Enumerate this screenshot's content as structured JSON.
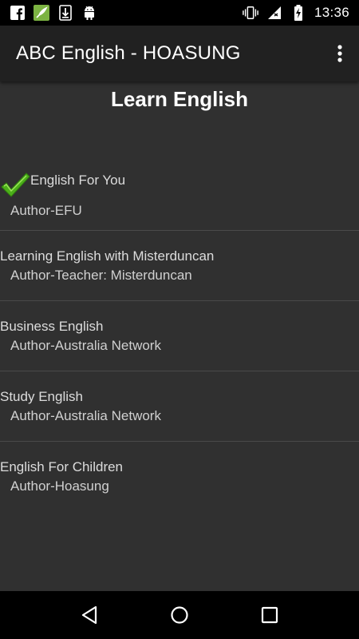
{
  "status_bar": {
    "time": "13:36",
    "left_icons": [
      "facebook-icon",
      "feather-app-icon",
      "download-icon",
      "android-icon"
    ],
    "right_icons": [
      "vibrate-icon",
      "signal-icon",
      "battery-charging-icon"
    ]
  },
  "app_bar": {
    "title": "ABC English - HOASUNG",
    "overflow_icon": "more-vert-icon"
  },
  "main": {
    "heading": "Learn English",
    "items": [
      {
        "title": "English For You",
        "author": "Author-EFU",
        "checked": true
      },
      {
        "title": "Learning English with Misterduncan",
        "author": "Author-Teacher: Misterduncan",
        "checked": false
      },
      {
        "title": "Business English",
        "author": "Author-Australia Network",
        "checked": false
      },
      {
        "title": "Study English",
        "author": "Author-Australia Network",
        "checked": false
      },
      {
        "title": "English For Children",
        "author": "Author-Hoasung",
        "checked": false
      }
    ]
  },
  "nav_bar": {
    "buttons": [
      "back-icon",
      "home-icon",
      "recents-icon"
    ]
  },
  "colors": {
    "background": "#303030",
    "app_bar": "#212121",
    "status_bar": "#000000",
    "check_green": "#4caf1a"
  }
}
